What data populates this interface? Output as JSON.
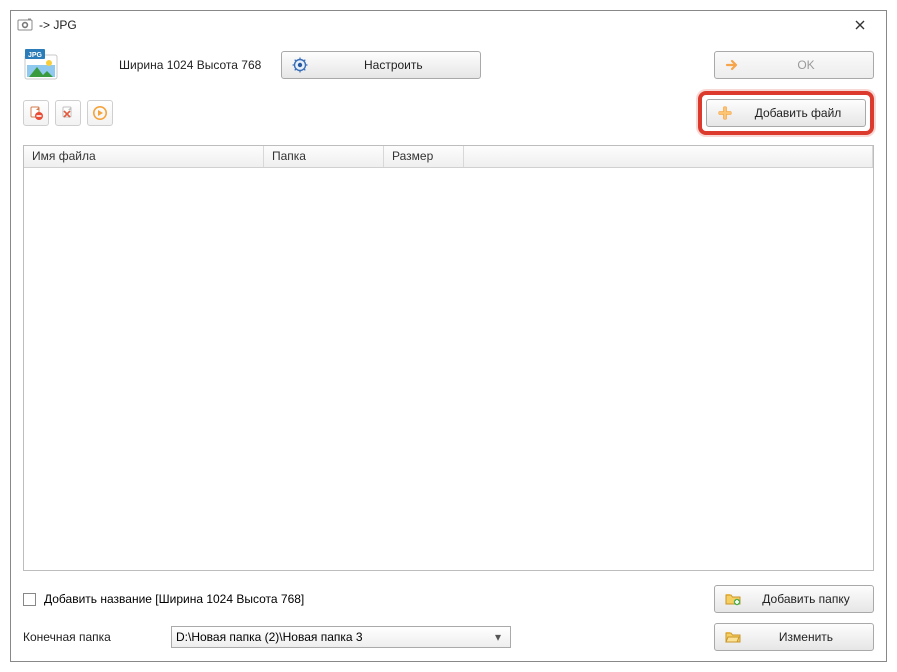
{
  "window": {
    "title": "-> JPG"
  },
  "top": {
    "format_label": "JPG",
    "dimensions": "Ширина 1024 Высота 768",
    "configure_label": "Настроить",
    "ok_label": "OK"
  },
  "actions": {
    "add_file_label": "Добавить файл"
  },
  "table": {
    "columns": {
      "name": "Имя файла",
      "folder": "Папка",
      "size": "Размер"
    }
  },
  "bottom": {
    "add_title_label": "Добавить название [Ширина 1024 Высота 768]",
    "add_folder_label": "Добавить папку",
    "dest_label": "Конечная папка",
    "dest_value": "D:\\Новая папка (2)\\Новая папка 3",
    "change_label": "Изменить"
  }
}
